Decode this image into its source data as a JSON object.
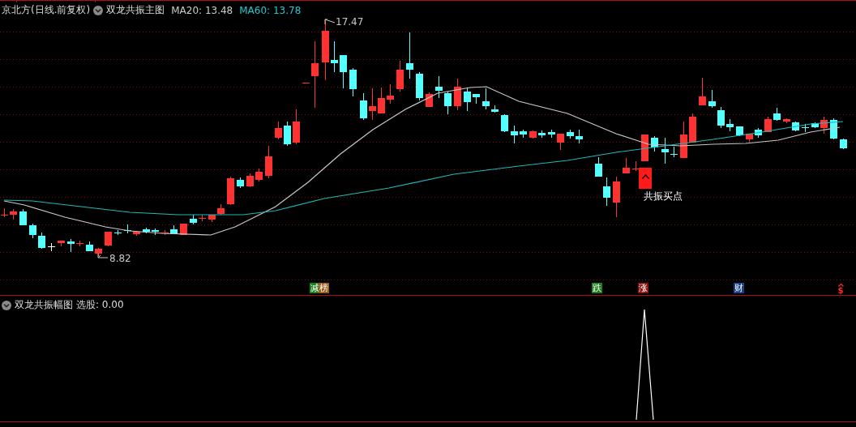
{
  "header": {
    "stock": "京北方(日线.前复权)",
    "indicator": "双龙共振主图",
    "ma20": "MA20: 13.48",
    "ma60": "MA60: 13.78"
  },
  "main_chart": {
    "high_label": "17.47",
    "low_label": "8.82",
    "signal_label": "共振买点"
  },
  "markers": [
    {
      "text": "减",
      "color": "#1c7f1c"
    },
    {
      "text": "榜",
      "color": "#9c5a18"
    },
    {
      "text": "跌",
      "color": "#1c7f1c"
    },
    {
      "text": "涨",
      "color": "#8a1010"
    },
    {
      "text": "财",
      "color": "#1d3f86"
    }
  ],
  "dollar_marker": {
    "text": "$"
  },
  "sub_panel": {
    "title": "双龙共振幅图",
    "reading": "选股: 0.00"
  }
}
